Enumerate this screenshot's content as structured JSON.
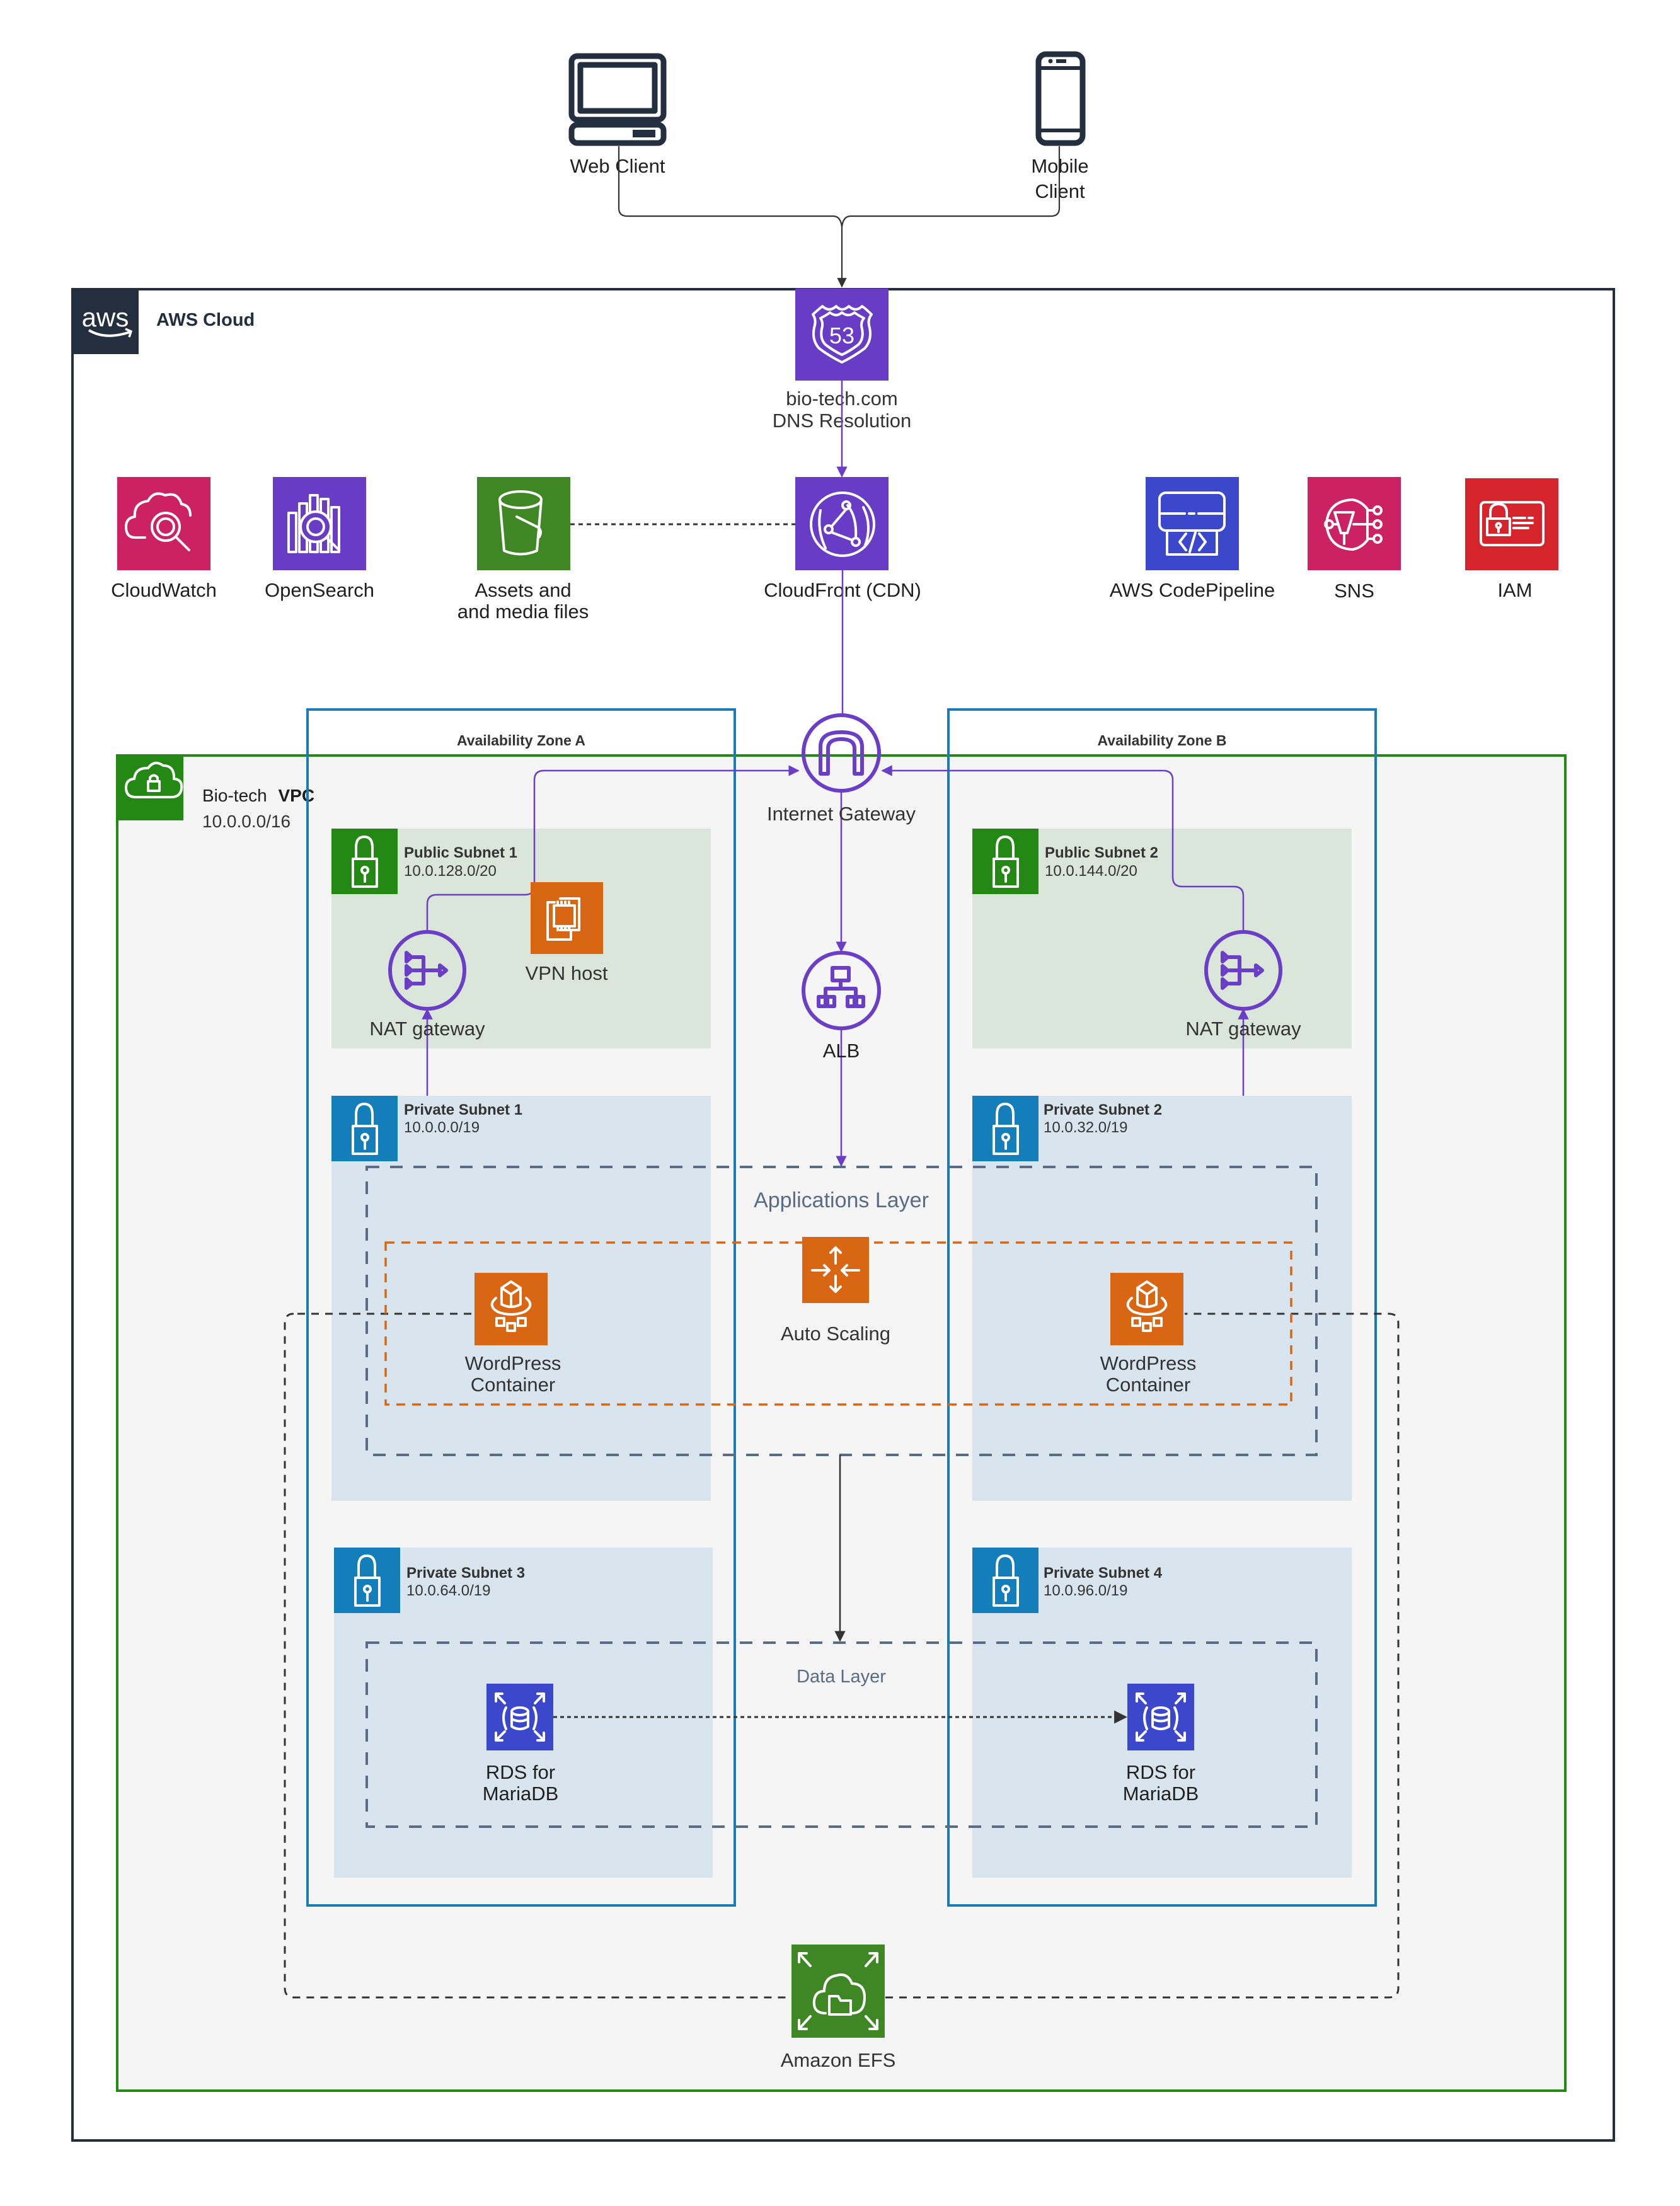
{
  "clients": {
    "web": {
      "label": "Web Client",
      "icon": "desktop-computer-icon"
    },
    "mobile": {
      "label_line1": "Mobile",
      "label_line2": "Client",
      "icon": "mobile-phone-icon"
    }
  },
  "aws_cloud": {
    "title": "AWS Cloud",
    "logo_text": "aws",
    "border_color": "#232f3e"
  },
  "route53": {
    "label_line1": "bio-tech.com",
    "label_line2": "DNS Resolution",
    "badge_text": "53",
    "color": "#693cc5"
  },
  "services": {
    "cloudwatch": {
      "label": "CloudWatch",
      "color": "#cc2264"
    },
    "opensearch": {
      "label": "OpenSearch",
      "color": "#693cc5"
    },
    "s3": {
      "label_line1": "Assets and",
      "label_line2": "and media files",
      "color": "#3f8624"
    },
    "cloudfront": {
      "label": "CloudFront (CDN)",
      "color": "#693cc5"
    },
    "codepipeline": {
      "label": "AWS CodePipeline",
      "color": "#3b48cc"
    },
    "sns": {
      "label": "SNS",
      "color": "#cc2264"
    },
    "iam": {
      "label": "IAM",
      "color": "#d6242d"
    }
  },
  "vpc": {
    "name_prefix": "Bio-tech",
    "name_bold": "VPC",
    "cidr": "10.0.0.0/16",
    "color": "#248814"
  },
  "availability_zones": [
    {
      "title": "Availability Zone A"
    },
    {
      "title": "Availability Zone B"
    }
  ],
  "internet_gateway": {
    "label": "Internet Gateway"
  },
  "alb": {
    "label": "ALB"
  },
  "public_subnets": [
    {
      "name": "Public Subnet 1",
      "cidr": "10.0.128.0/20",
      "nat_label": "NAT gateway"
    },
    {
      "name": "Public Subnet 2",
      "cidr": "10.0.144.0/20",
      "nat_label": "NAT gateway"
    }
  ],
  "vpn_host": {
    "label": "VPN host",
    "color": "#d86613"
  },
  "private_subnets": [
    {
      "name": "Private Subnet 1",
      "cidr": "10.0.0.0/19"
    },
    {
      "name": "Private Subnet 2",
      "cidr": "10.0.32.0/19"
    },
    {
      "name": "Private Subnet 3",
      "cidr": "10.0.64.0/19"
    },
    {
      "name": "Private Subnet 4",
      "cidr": "10.0.96.0/19"
    }
  ],
  "applications_layer": {
    "title": "Applications Layer"
  },
  "auto_scaling": {
    "label": "Auto Scaling",
    "color": "#d86613"
  },
  "wordpress": [
    {
      "label_line1": "WordPress",
      "label_line2": "Container"
    },
    {
      "label_line1": "WordPress",
      "label_line2": "Container"
    }
  ],
  "data_layer": {
    "title": "Data Layer"
  },
  "rds": [
    {
      "label_line1": "RDS for",
      "label_line2": "MariaDB",
      "color": "#3b48cc"
    },
    {
      "label_line1": "RDS for",
      "label_line2": "MariaDB",
      "color": "#3b48cc"
    }
  ],
  "efs": {
    "label": "Amazon EFS",
    "color": "#3f8624"
  },
  "colors": {
    "flow_purple": "#6a3ec6",
    "az_blue": "#1a7bb9",
    "private_subnet_fill": "#d8e5ee",
    "public_subnet_fill": "#dbe6da",
    "layer_dash": "#5a6b86",
    "asg_dash": "#d86613"
  }
}
